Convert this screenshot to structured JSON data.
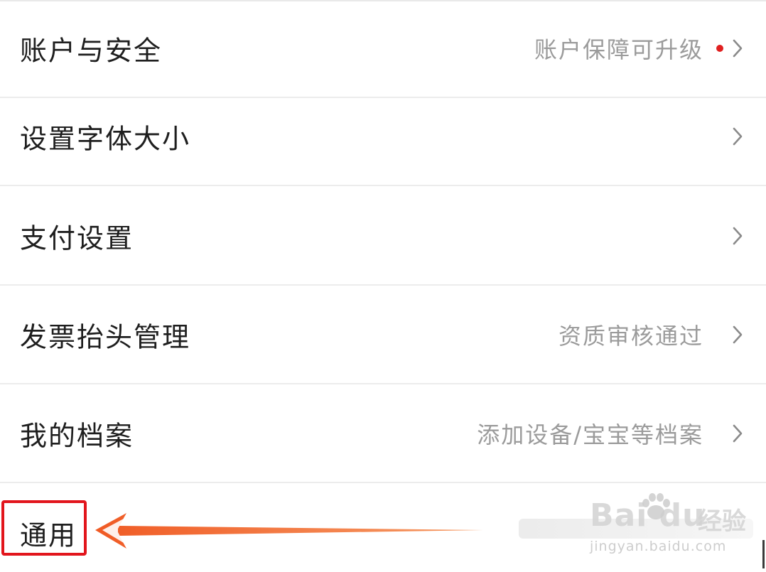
{
  "settings_list": {
    "items": [
      {
        "label": "账户与安全",
        "value": "账户保障可升级",
        "has_dot": true,
        "chevron": "›"
      },
      {
        "label": "设置字体大小",
        "value": "",
        "has_dot": false,
        "chevron": "›"
      },
      {
        "label": "支付设置",
        "value": "",
        "has_dot": false,
        "chevron": "›"
      },
      {
        "label": "发票抬头管理",
        "value": "资质审核通过",
        "has_dot": false,
        "chevron": "›"
      },
      {
        "label": "我的档案",
        "value": "添加设备/宝宝等档案",
        "has_dot": false,
        "chevron": "›"
      },
      {
        "label": "通用",
        "value": "",
        "has_dot": false,
        "chevron": ""
      }
    ]
  },
  "annotation": {
    "box_color": "#e2151c",
    "arrow_color": "#f06a2c"
  },
  "watermark": {
    "logo": "Bai  du",
    "cn": "经验",
    "url": "jingyan.baidu.com"
  },
  "colors": {
    "dot": "#e02020",
    "label": "#1e1e1e",
    "value": "#9b9b9b",
    "divider": "#ececec"
  }
}
